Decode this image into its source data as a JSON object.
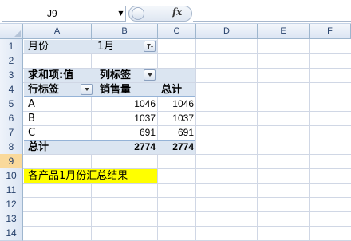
{
  "formula_bar": {
    "name_box": "J9",
    "fx_label": "fx",
    "formula": ""
  },
  "columns": [
    "A",
    "B",
    "C",
    "D",
    "E",
    "F"
  ],
  "rows": [
    "1",
    "2",
    "3",
    "4",
    "5",
    "6",
    "7",
    "8",
    "9",
    "10",
    "11",
    "12",
    "13",
    "14"
  ],
  "selected_row": "9",
  "filter": {
    "label": "月份",
    "value": "1月"
  },
  "pivot": {
    "value_header": "求和项:值",
    "col_label": "列标签",
    "row_label": "行标签",
    "col_sales": "销售量",
    "col_total": "总计",
    "rows": [
      {
        "label": "A",
        "sales": "1046",
        "total": "1046"
      },
      {
        "label": "B",
        "sales": "1037",
        "total": "1037"
      },
      {
        "label": "C",
        "sales": "691",
        "total": "691"
      }
    ],
    "grand_total": {
      "label": "总计",
      "sales": "2774",
      "total": "2774"
    }
  },
  "note": "各产品1月份汇总结果",
  "colors": {
    "pivot_header_fill": "#dbe5f1",
    "highlight": "#ffff00"
  }
}
